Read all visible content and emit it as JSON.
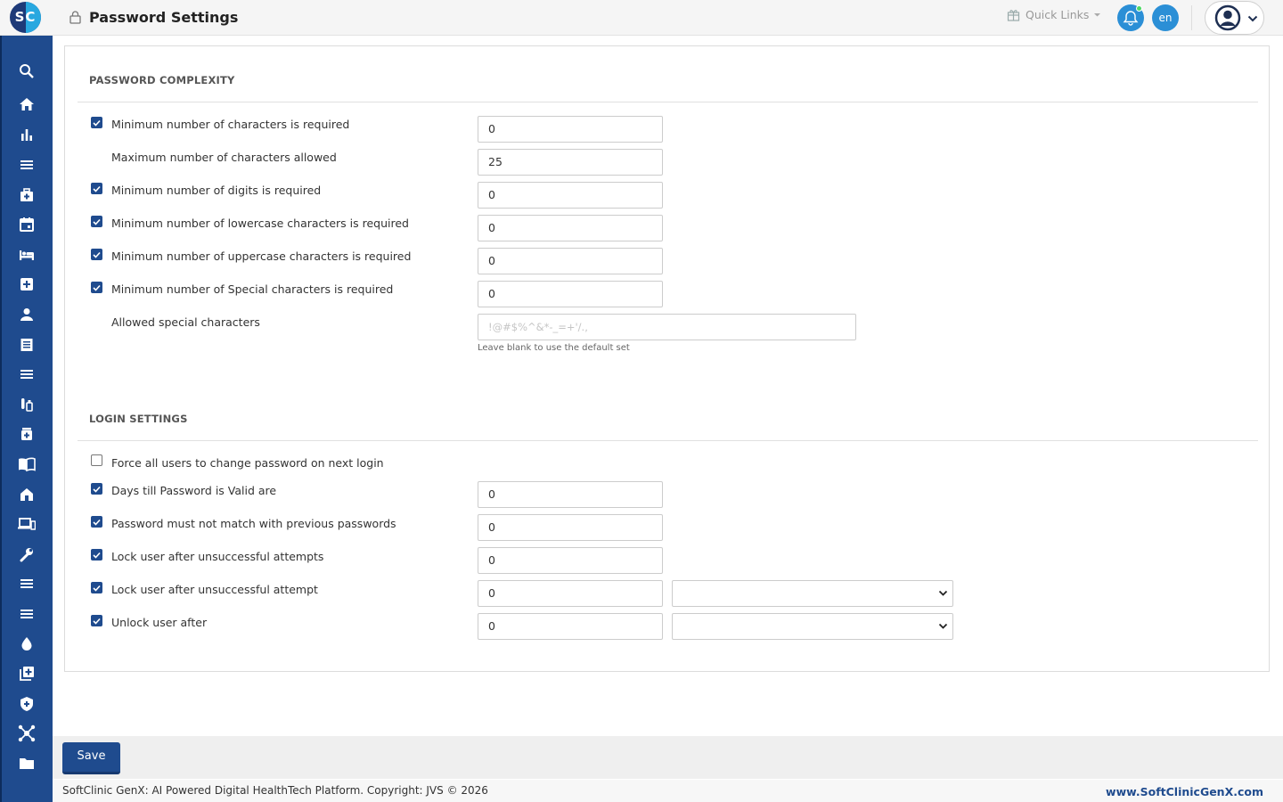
{
  "app": {
    "logo_text": "SC",
    "page_title": "Password Settings"
  },
  "header": {
    "quick_links": "Quick Links",
    "language": "en"
  },
  "sidebar": {
    "icons": [
      "search-icon",
      "home-icon",
      "bar-chart-icon",
      "menu-icon",
      "medical-bag-icon",
      "calendar-icon",
      "bed-icon",
      "medical-plus-icon",
      "person-icon",
      "receipt-icon",
      "list-icon",
      "lab-tubes-icon",
      "medicine-icon",
      "book-icon",
      "hospital-icon",
      "devices-icon",
      "wrench-icon",
      "menu-icon",
      "menu-icon",
      "drop-icon",
      "add-box-icon",
      "shield-icon",
      "hub-icon",
      "folder-icon"
    ]
  },
  "password_complexity": {
    "title": "PASSWORD COMPLEXITY",
    "rows": [
      {
        "label": "Minimum number of characters is required",
        "checked": true,
        "value": "0"
      },
      {
        "label": "Maximum number of characters allowed",
        "checked": null,
        "value": "25"
      },
      {
        "label": "Minimum number of digits is required",
        "checked": true,
        "value": "0"
      },
      {
        "label": "Minimum number of lowercase characters is required",
        "checked": true,
        "value": "0"
      },
      {
        "label": "Minimum number of uppercase characters is required",
        "checked": true,
        "value": "0"
      },
      {
        "label": "Minimum number of Special characters is required",
        "checked": true,
        "value": "0"
      }
    ],
    "allowed_special": {
      "label": "Allowed special characters",
      "placeholder": "!@#$%^&*-_=+'/.,",
      "help": "Leave blank to use the default set"
    }
  },
  "login_settings": {
    "title": "LOGIN SETTINGS",
    "force_change": {
      "label": "Force all users to change password on next login",
      "checked": false
    },
    "rows": [
      {
        "label": "Days till Password is Valid are",
        "checked": true,
        "value": "0"
      },
      {
        "label": "Password must not match with previous passwords",
        "checked": true,
        "value": "0"
      },
      {
        "label": "Lock user after unsuccessful attempts",
        "checked": true,
        "value": "0"
      },
      {
        "label": "Lock user after unsuccessful attempt",
        "checked": true,
        "value": "0",
        "select": ""
      },
      {
        "label": "Unlock user after",
        "checked": true,
        "value": "0",
        "select": ""
      }
    ]
  },
  "actions": {
    "save": "Save"
  },
  "footer": {
    "copyright": "SoftClinic GenX: AI Powered Digital HealthTech Platform. Copyright: JVS © 2026",
    "website": "www.SoftClinicGenX.com"
  },
  "colors": {
    "primary": "#1f4b8e",
    "accent": "#28a8e0",
    "notification": "#2b8fd6"
  }
}
